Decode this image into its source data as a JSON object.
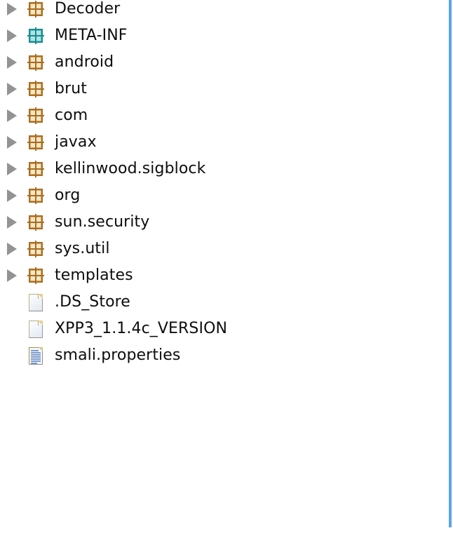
{
  "panel": {
    "name": "apk-resource-tree",
    "background": "#ffffff",
    "accent_rail_color": "#5ba4e5"
  },
  "colors": {
    "package_orange_dark": "#a86d24",
    "package_orange_fill": "#d8a85f",
    "package_orange_light": "#f6e7c5",
    "package_teal_dark": "#1b8a8f",
    "package_teal_fill": "#53c3c6",
    "package_teal_light": "#aee3e4",
    "twisty_gray": "#939393",
    "text": "#0d0d0d",
    "document_border": "#b9ae86",
    "properties_line": "#7d9ccb"
  },
  "tree": {
    "rows": [
      {
        "label": "Decoder",
        "icon": "package-icon",
        "icon_color": "orange",
        "expandable": true,
        "expanded": false
      },
      {
        "label": "META-INF",
        "icon": "package-icon",
        "icon_color": "teal",
        "expandable": true,
        "expanded": false
      },
      {
        "label": "android",
        "icon": "package-icon",
        "icon_color": "orange",
        "expandable": true,
        "expanded": false
      },
      {
        "label": "brut",
        "icon": "package-icon",
        "icon_color": "orange",
        "expandable": true,
        "expanded": false
      },
      {
        "label": "com",
        "icon": "package-icon",
        "icon_color": "orange",
        "expandable": true,
        "expanded": false
      },
      {
        "label": "javax",
        "icon": "package-icon",
        "icon_color": "orange",
        "expandable": true,
        "expanded": false
      },
      {
        "label": "kellinwood.sigblock",
        "icon": "package-icon",
        "icon_color": "orange",
        "expandable": true,
        "expanded": false
      },
      {
        "label": "org",
        "icon": "package-icon",
        "icon_color": "orange",
        "expandable": true,
        "expanded": false
      },
      {
        "label": "sun.security",
        "icon": "package-icon",
        "icon_color": "orange",
        "expandable": true,
        "expanded": false
      },
      {
        "label": "sys.util",
        "icon": "package-icon",
        "icon_color": "orange",
        "expandable": true,
        "expanded": false
      },
      {
        "label": "templates",
        "icon": "package-icon",
        "icon_color": "orange",
        "expandable": true,
        "expanded": false
      },
      {
        "label": ".DS_Store",
        "icon": "file-document-icon",
        "icon_color": "gray",
        "expandable": false,
        "expanded": false
      },
      {
        "label": "XPP3_1.1.4c_VERSION",
        "icon": "file-document-icon",
        "icon_color": "gray",
        "expandable": false,
        "expanded": false
      },
      {
        "label": "smali.properties",
        "icon": "file-properties-icon",
        "icon_color": "tan",
        "expandable": false,
        "expanded": false
      }
    ]
  }
}
